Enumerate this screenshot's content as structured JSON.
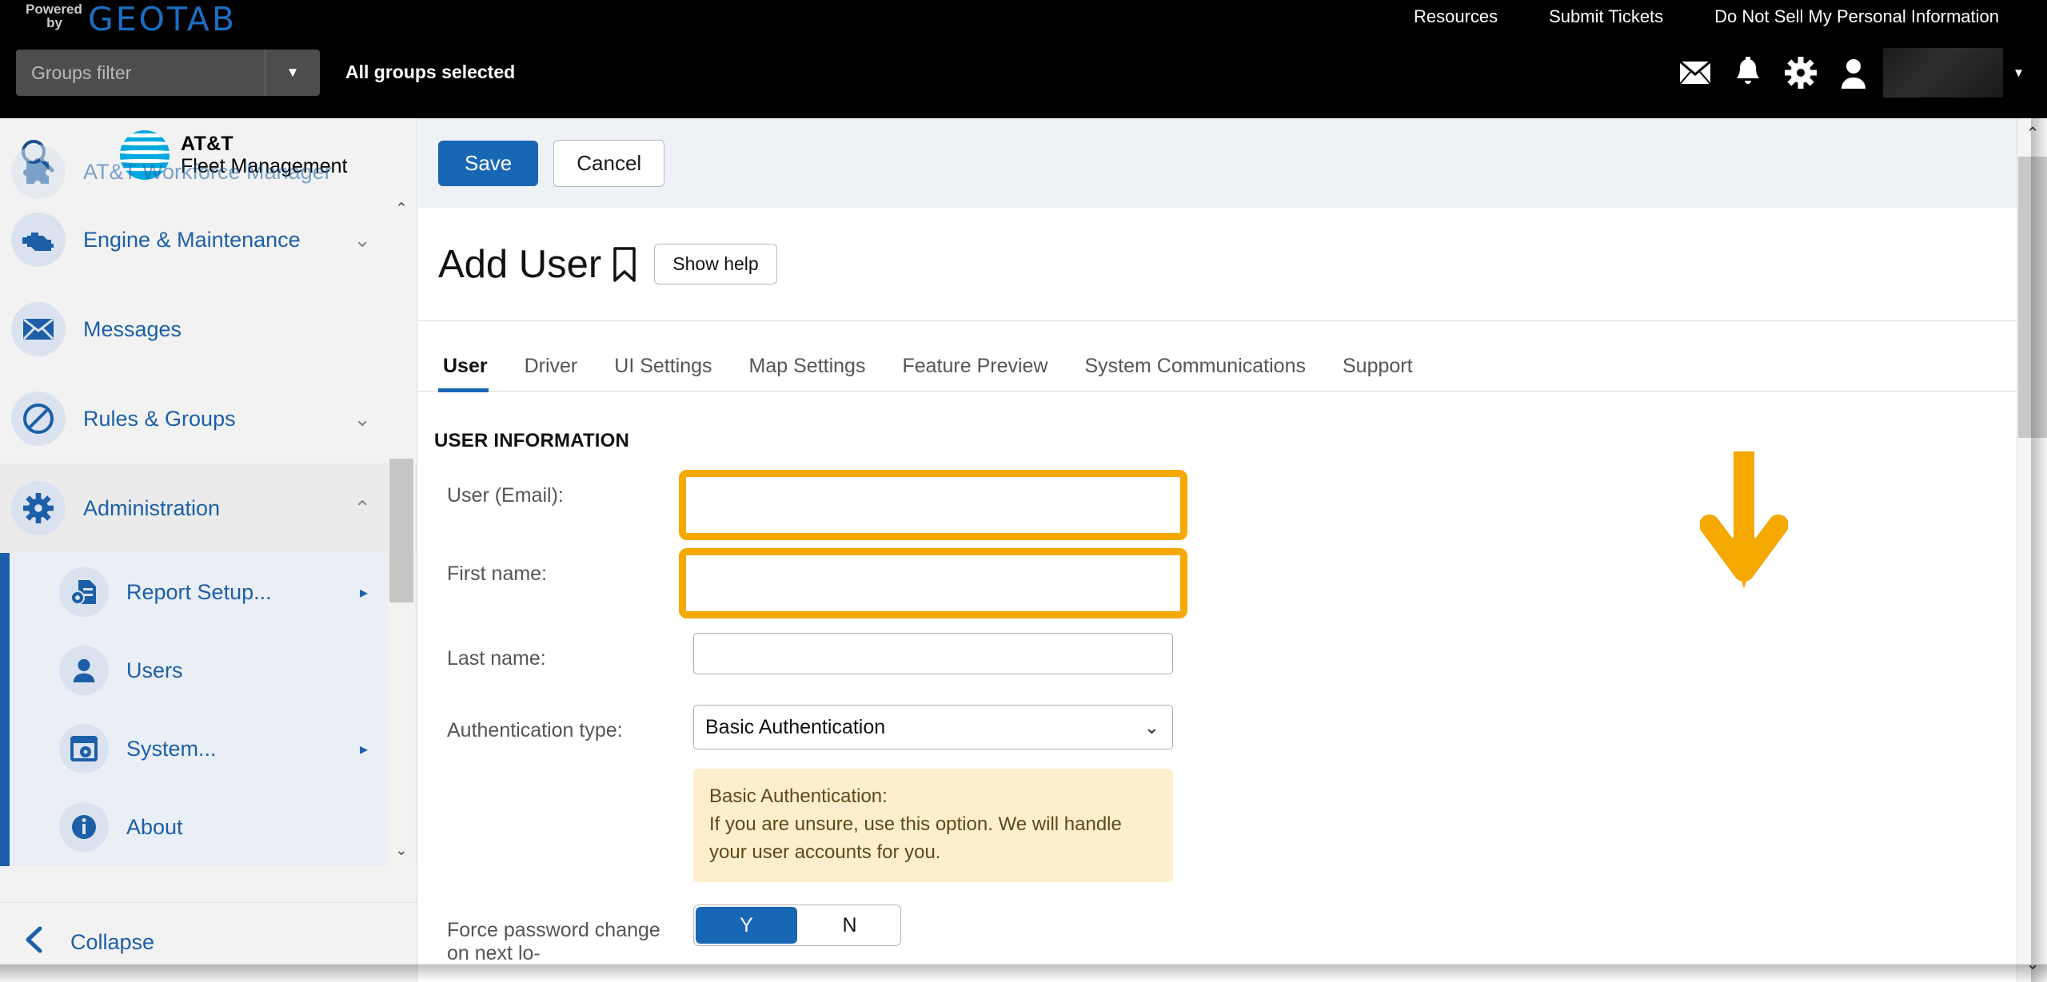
{
  "topbar": {
    "powered_line1": "Powered",
    "powered_line2": "by",
    "brand": "GEOTAB",
    "groups_filter_placeholder": "Groups filter",
    "groups_filter_value": "",
    "groups_status": "All groups selected",
    "links": [
      {
        "label": "Resources"
      },
      {
        "label": "Submit Tickets"
      },
      {
        "label": "Do Not Sell My Personal Information"
      }
    ],
    "icons": [
      {
        "name": "mail-icon",
        "glyph": "✉"
      },
      {
        "name": "bell-icon",
        "glyph": "🔔"
      },
      {
        "name": "gear-icon",
        "glyph": "⚙"
      },
      {
        "name": "person-icon",
        "glyph": "👤"
      }
    ],
    "user_caret": "▼"
  },
  "sidebar": {
    "app_name_line1": "AT&T",
    "app_name_line2": "Fleet Management",
    "search_icon": "search-icon",
    "items": [
      {
        "label": "AT&T Workforce Manager",
        "icon": "puzzle-icon",
        "chevron": "",
        "cut": true
      },
      {
        "label": "Engine & Maintenance",
        "icon": "engine-icon",
        "chevron": "⌄"
      },
      {
        "label": "Messages",
        "icon": "envelope-icon",
        "chevron": ""
      },
      {
        "label": "Rules & Groups",
        "icon": "prohibited-icon",
        "chevron": "⌄"
      },
      {
        "label": "Administration",
        "icon": "gear-icon",
        "chevron": "⌃"
      }
    ],
    "sub_items": [
      {
        "label": "Report Setup...",
        "icon": "report-setup-icon",
        "arrow": "▸"
      },
      {
        "label": "Users",
        "icon": "user-icon",
        "arrow": ""
      },
      {
        "label": "System...",
        "icon": "system-icon",
        "arrow": "▸"
      },
      {
        "label": "About",
        "icon": "info-icon",
        "arrow": ""
      }
    ],
    "collapse_label": "Collapse",
    "collapse_icon": "chevron-left-icon"
  },
  "toolbar": {
    "save_label": "Save",
    "cancel_label": "Cancel"
  },
  "page": {
    "title": "Add User",
    "bookmark_icon": "bookmark-icon",
    "show_help_label": "Show help"
  },
  "tabs": [
    {
      "label": "User",
      "active": true
    },
    {
      "label": "Driver",
      "active": false
    },
    {
      "label": "UI Settings",
      "active": false
    },
    {
      "label": "Map Settings",
      "active": false
    },
    {
      "label": "Feature Preview",
      "active": false
    },
    {
      "label": "System Communications",
      "active": false
    },
    {
      "label": "Support",
      "active": false
    }
  ],
  "form": {
    "section_title": "USER INFORMATION",
    "fields": {
      "email_label": "User (Email):",
      "email_value": "",
      "first_name_label": "First name:",
      "first_name_value": "",
      "last_name_label": "Last name:",
      "last_name_value": "",
      "auth_type_label": "Authentication type:",
      "auth_type_value": "Basic Authentication",
      "auth_chevron": "⌄",
      "force_password_label": "Force password change on next lo-"
    },
    "info_box": {
      "title": "Basic Authentication:",
      "body": "If you are unsure, use this option. We will handle your user accounts for you."
    },
    "toggle": {
      "yes_label": "Y",
      "no_label": "N"
    }
  },
  "scrollbars": {
    "sidebar_up": "⌃",
    "sidebar_down": "⌄",
    "outer_up": "⌃",
    "outer_down": "⌄"
  },
  "annotation": {
    "arrow_name": "down-arrow-annotation",
    "color": "#f5a800"
  },
  "colors": {
    "accent_blue": "#1867b5",
    "highlight_orange": "#f5a800",
    "info_bg": "#fdefcc",
    "topbar_bg": "#000000",
    "sidebar_bg": "#f2f2f2",
    "toolbar_bg": "#eef1f6"
  }
}
